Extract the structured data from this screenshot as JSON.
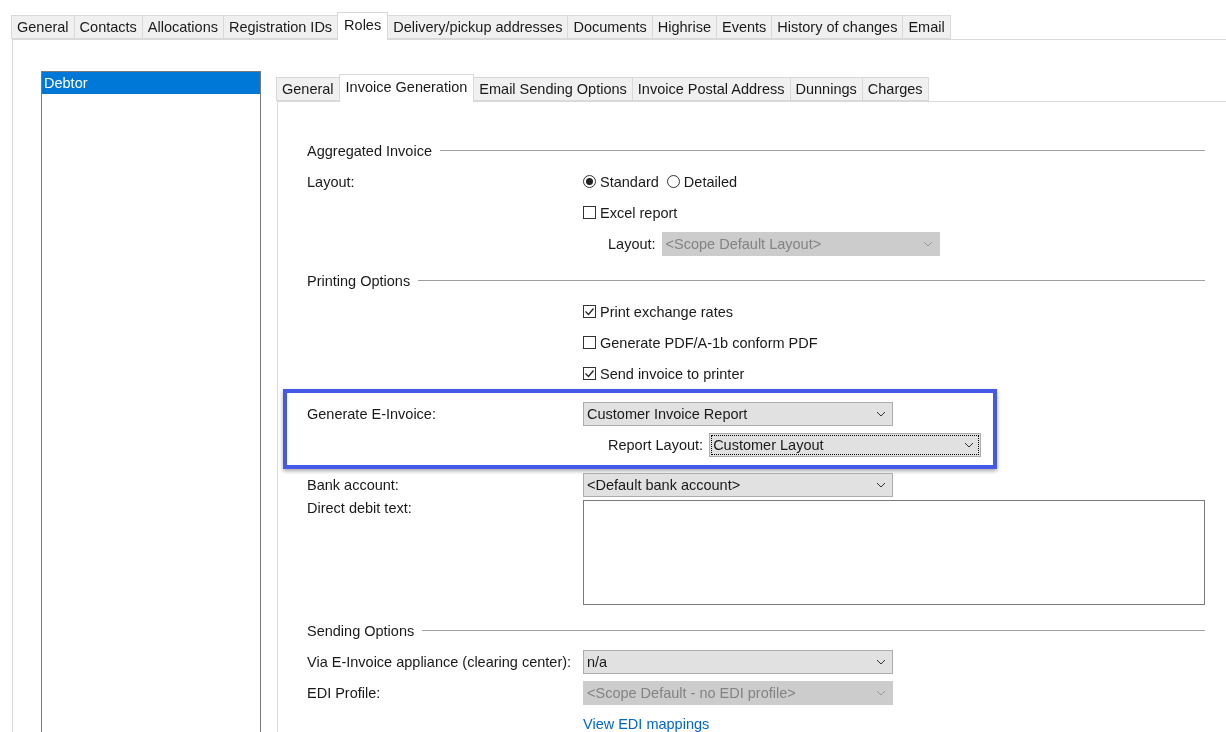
{
  "tabs": [
    {
      "label": "General",
      "selected": false
    },
    {
      "label": "Contacts",
      "selected": false
    },
    {
      "label": "Allocations",
      "selected": false
    },
    {
      "label": "Registration IDs",
      "selected": false
    },
    {
      "label": "Roles",
      "selected": true
    },
    {
      "label": "Delivery/pickup addresses",
      "selected": false
    },
    {
      "label": "Documents",
      "selected": false
    },
    {
      "label": "Highrise",
      "selected": false
    },
    {
      "label": "Events",
      "selected": false
    },
    {
      "label": "History of changes",
      "selected": false
    },
    {
      "label": "Email",
      "selected": false
    }
  ],
  "roles": [
    {
      "label": "Debtor",
      "selected": true
    }
  ],
  "sub_tabs": [
    {
      "label": "General",
      "selected": false
    },
    {
      "label": "Invoice Generation",
      "selected": true
    },
    {
      "label": "Email Sending Options",
      "selected": false
    },
    {
      "label": "Invoice Postal Address",
      "selected": false
    },
    {
      "label": "Dunnings",
      "selected": false
    },
    {
      "label": "Charges",
      "selected": false
    }
  ],
  "sections": [
    {
      "title": "Aggregated Invoice",
      "rows": [
        {
          "kind": "radio",
          "label": "Layout:",
          "options": [
            {
              "label": "Standard",
              "selected": true
            },
            {
              "label": "Detailed",
              "selected": false
            }
          ]
        },
        {
          "kind": "checkbox",
          "label": "Excel report",
          "checked": false
        },
        {
          "kind": "subselect",
          "label": "Layout:",
          "value": "<Scope Default Layout>",
          "disabled": true,
          "focused": false
        }
      ]
    },
    {
      "title": "Printing Options",
      "rows": [
        {
          "kind": "checkbox",
          "label": "Print exchange rates",
          "checked": true
        },
        {
          "kind": "checkbox",
          "label": "Generate PDF/A-1b conform PDF",
          "checked": false
        },
        {
          "kind": "checkbox",
          "label": "Send invoice to printer",
          "checked": true
        },
        {
          "kind": "group",
          "highlighted": true,
          "rows": [
            {
              "kind": "select",
              "label": "Generate E-Invoice:",
              "value": "Customer Invoice Report",
              "disabled": false,
              "focused": false
            },
            {
              "kind": "subselect",
              "label": "Report Layout:",
              "value": "Customer Layout",
              "disabled": false,
              "focused": true
            }
          ]
        },
        {
          "kind": "select",
          "label": "Bank account:",
          "value": "<Default bank account>",
          "disabled": false,
          "focused": false
        },
        {
          "kind": "textarea",
          "label": "Direct debit text:"
        }
      ]
    },
    {
      "title": "Sending Options",
      "rows": [
        {
          "kind": "select",
          "label": "Via E-Invoice appliance (clearing center):",
          "value": "n/a",
          "disabled": false,
          "focused": false
        },
        {
          "kind": "select",
          "label": "EDI Profile:",
          "value": "<Scope Default - no EDI profile>",
          "disabled": true,
          "focused": false
        },
        {
          "kind": "link",
          "label": "View EDI mappings"
        }
      ]
    }
  ]
}
